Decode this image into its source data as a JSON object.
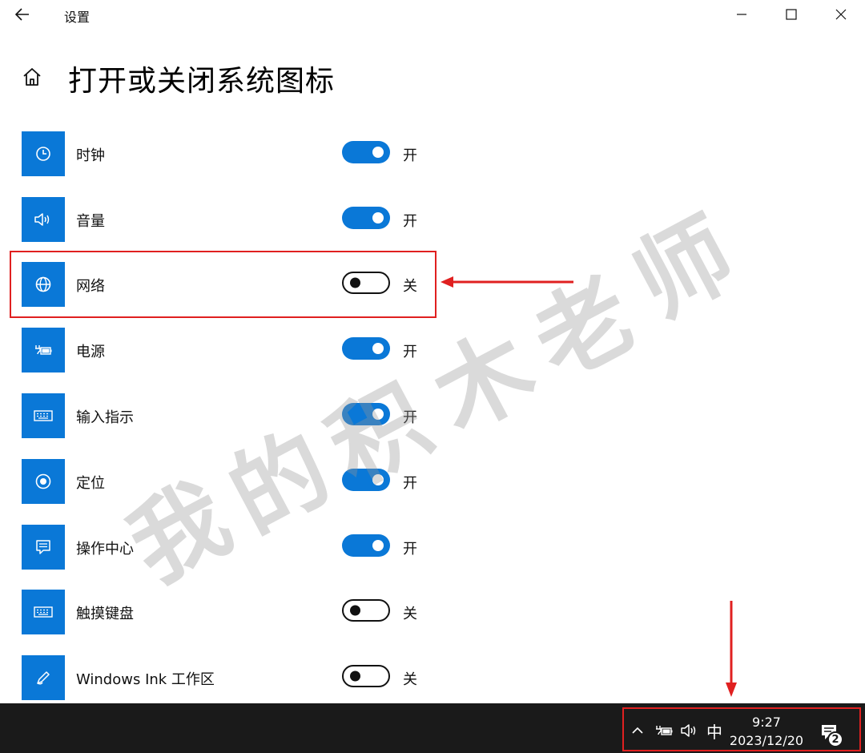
{
  "titlebar": {
    "app_title": "设置",
    "back_icon": "arrow-left-icon",
    "minimize_icon": "minimize-icon",
    "maximize_icon": "maximize-icon",
    "close_icon": "close-icon"
  },
  "header": {
    "home_icon": "home-icon",
    "title": "打开或关闭系统图标"
  },
  "rows": [
    {
      "label": "时钟",
      "icon": "clock-icon",
      "on": true,
      "state": "开"
    },
    {
      "label": "音量",
      "icon": "speaker-icon",
      "on": true,
      "state": "开"
    },
    {
      "label": "网络",
      "icon": "globe-icon",
      "on": false,
      "state": "关"
    },
    {
      "label": "电源",
      "icon": "battery-plug-icon",
      "on": true,
      "state": "开"
    },
    {
      "label": "输入指示",
      "icon": "keyboard-icon",
      "on": true,
      "state": "开"
    },
    {
      "label": "定位",
      "icon": "location-icon",
      "on": true,
      "state": "开"
    },
    {
      "label": "操作中心",
      "icon": "action-center-icon",
      "on": true,
      "state": "开"
    },
    {
      "label": "触摸键盘",
      "icon": "keyboard-icon",
      "on": false,
      "state": "关"
    },
    {
      "label": "Windows Ink 工作区",
      "icon": "pen-icon",
      "on": false,
      "state": "关"
    }
  ],
  "watermark": {
    "chars": [
      "我",
      "的",
      "积",
      "木",
      "老",
      "师"
    ]
  },
  "colors": {
    "accent": "#0a78d7",
    "annotation": "#e02020",
    "taskbar": "#1a1a1a"
  },
  "taskbar": {
    "chevron_icon": "chevron-up-icon",
    "power_icon": "battery-plug-icon",
    "volume_icon": "speaker-icon",
    "ime_label": "中",
    "time": "9:27",
    "date": "2023/12/20",
    "notification_icon": "notification-icon",
    "notification_count": "2"
  }
}
